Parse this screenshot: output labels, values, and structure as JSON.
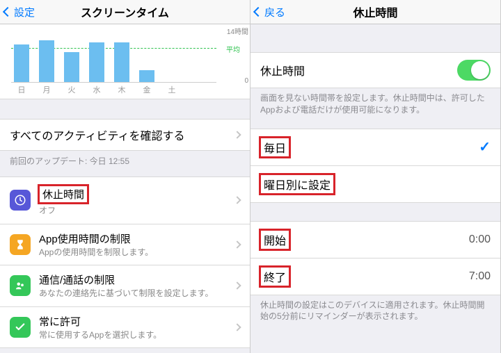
{
  "left": {
    "nav_back": "設定",
    "title": "スクリーンタイム",
    "chart_data": {
      "type": "bar",
      "categories": [
        "日",
        "月",
        "火",
        "水",
        "木",
        "金",
        "土"
      ],
      "values": [
        9.5,
        10.5,
        7.5,
        10,
        10,
        3,
        0
      ],
      "ylabel_top": "14時間",
      "ylabel_bottom": "0",
      "avg_label": "平均",
      "ylim": [
        0,
        14
      ]
    },
    "all_activity": "すべてのアクティビティを確認する",
    "last_update": "前回のアップデート: 今日 12:55",
    "rows": {
      "downtime": {
        "title": "休止時間",
        "sub": "オフ"
      },
      "app_limits": {
        "title": "App使用時間の制限",
        "sub": "Appの使用時間を制限します。"
      },
      "comm": {
        "title": "通信/通話の制限",
        "sub": "あなたの連絡先に基づいて制限を設定します。"
      },
      "always": {
        "title": "常に許可",
        "sub": "常に使用するAppを選択します。"
      }
    }
  },
  "right": {
    "nav_back": "戻る",
    "title": "休止時間",
    "toggle": {
      "label": "休止時間",
      "on": true
    },
    "toggle_note": "画面を見ない時間帯を設定します。休止時間中は、許可したAppおよび電話だけが使用可能になります。",
    "schedule": {
      "every_day": "毎日",
      "custom": "曜日別に設定"
    },
    "time": {
      "start_label": "開始",
      "start_value": "0:00",
      "end_label": "終了",
      "end_value": "7:00"
    },
    "time_note": "休止時間の設定はこのデバイスに適用されます。休止時間開始の5分前にリマインダーが表示されます。"
  }
}
